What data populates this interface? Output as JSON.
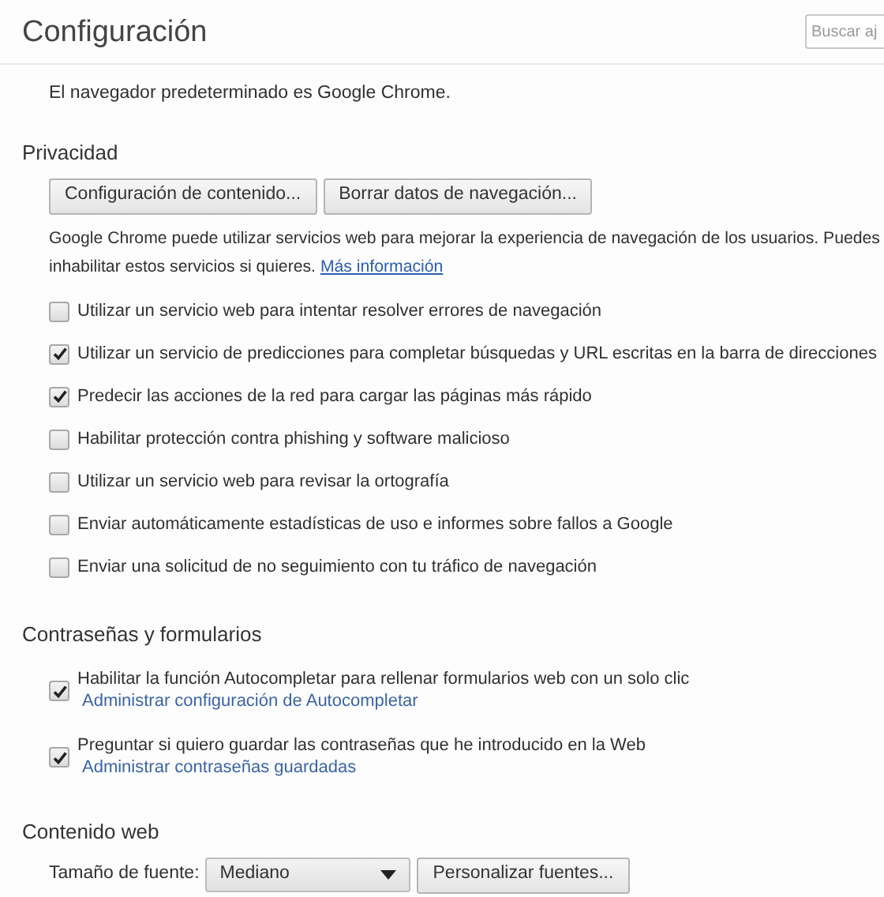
{
  "header": {
    "title": "Configuración",
    "search": {
      "placeholder": "Buscar aj"
    }
  },
  "default_browser": {
    "text": "El navegador predeterminado es Google Chrome."
  },
  "privacy": {
    "title": "Privacidad",
    "buttons": [
      "Configuración de contenido...",
      "Borrar datos de navegación..."
    ],
    "description": "Google Chrome puede utilizar servicios web para mejorar la experiencia de navegación de los usuarios. Puedes inhabilitar estos servicios si quieres.",
    "link": "Más información",
    "options": [
      {
        "label": "Utilizar un servicio web para intentar resolver errores de navegación",
        "checked": false
      },
      {
        "label": "Utilizar un servicio de predicciones para completar búsquedas y URL escritas en la barra de direcciones",
        "checked": true
      },
      {
        "label": "Predecir las acciones de la red para cargar las páginas más rápido",
        "checked": true
      },
      {
        "label": "Habilitar protección contra phishing y software malicioso",
        "checked": false
      },
      {
        "label": "Utilizar un servicio web para revisar la ortografía",
        "checked": false
      },
      {
        "label": "Enviar automáticamente estadísticas de uso e informes sobre fallos a Google",
        "checked": false
      },
      {
        "label": "Enviar una solicitud de no seguimiento con tu tráfico de navegación",
        "checked": false
      }
    ]
  },
  "passwords": {
    "title": "Contraseñas y formularios",
    "options": [
      {
        "label": "Habilitar la función Autocompletar para rellenar formularios web con un solo clic",
        "checked": true,
        "link": "Administrar configuración de Autocompletar"
      },
      {
        "label": "Preguntar si quiero guardar las contraseñas que he introducido en la Web",
        "checked": true,
        "link": "Administrar contraseñas guardadas"
      }
    ]
  },
  "web_content": {
    "title": "Contenido web",
    "font_size": {
      "label": "Tamaño de fuente:",
      "value": "Mediano"
    },
    "button": "Personalizar fuentes..."
  }
}
